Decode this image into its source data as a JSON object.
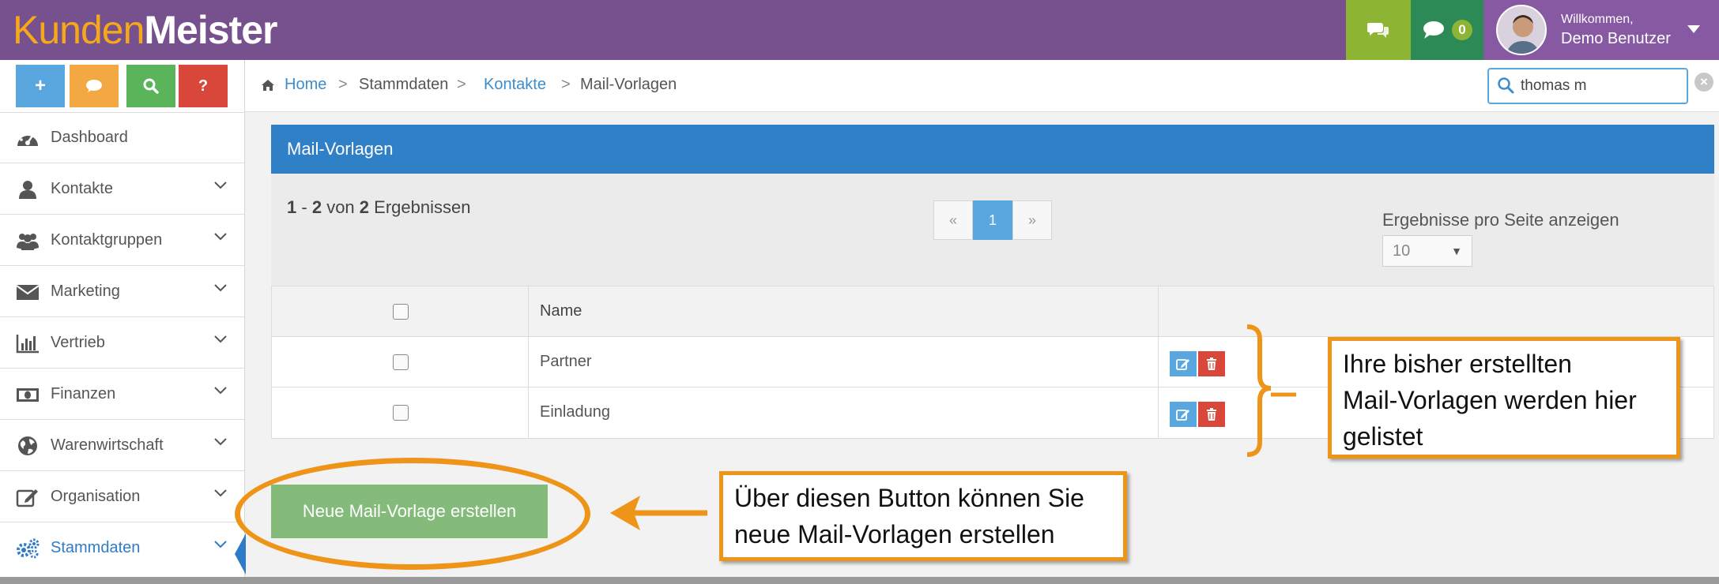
{
  "logo": {
    "part1": "Kunden",
    "part2": "Meister"
  },
  "topbar": {
    "messages_count": "0",
    "welcome": "Willkommen,",
    "user_name": "Demo Benutzer"
  },
  "quick_actions": [
    "+",
    "?"
  ],
  "sidebar": {
    "items": [
      {
        "label": "Dashboard",
        "icon": "dashboard-icon"
      },
      {
        "label": "Kontakte",
        "icon": "user-icon"
      },
      {
        "label": "Kontaktgruppen",
        "icon": "users-icon"
      },
      {
        "label": "Marketing",
        "icon": "envelope-icon"
      },
      {
        "label": "Vertrieb",
        "icon": "bar-chart-icon"
      },
      {
        "label": "Finanzen",
        "icon": "money-icon"
      },
      {
        "label": "Warenwirtschaft",
        "icon": "globe-icon"
      },
      {
        "label": "Organisation",
        "icon": "edit-icon"
      },
      {
        "label": "Stammdaten",
        "icon": "gears-icon"
      }
    ]
  },
  "breadcrumb": {
    "home": "Home",
    "stammdaten": "Stammdaten",
    "kontakte": "Kontakte",
    "current": "Mail-Vorlagen",
    "sep": ">"
  },
  "search": {
    "value": "thomas m"
  },
  "panel": {
    "title": "Mail-Vorlagen",
    "results_from": "1",
    "results_to": "2",
    "results_of": "von",
    "results_total": "2",
    "results_label": "Ergebnissen",
    "pager": {
      "prev": "«",
      "current": "1",
      "next": "»"
    },
    "per_page_label": "Ergebnisse pro Seite anzeigen",
    "per_page_value": "10"
  },
  "table": {
    "header_name": "Name",
    "rows": [
      {
        "name": "Partner"
      },
      {
        "name": "Einladung"
      }
    ]
  },
  "new_button": "Neue Mail-Vorlage erstellen",
  "annotations": {
    "list_note": [
      "Ihre bisher erstellten",
      "Mail-Vorlagen werden hier",
      "gelistet"
    ],
    "button_note": [
      "Über diesen Button können Sie",
      "neue Mail-Vorlagen erstellen"
    ]
  },
  "colors": {
    "topbar": "#77508e",
    "accent_blue": "#3080c8",
    "annotation_orange": "#ee9519",
    "new_button": "#84bb7a"
  }
}
